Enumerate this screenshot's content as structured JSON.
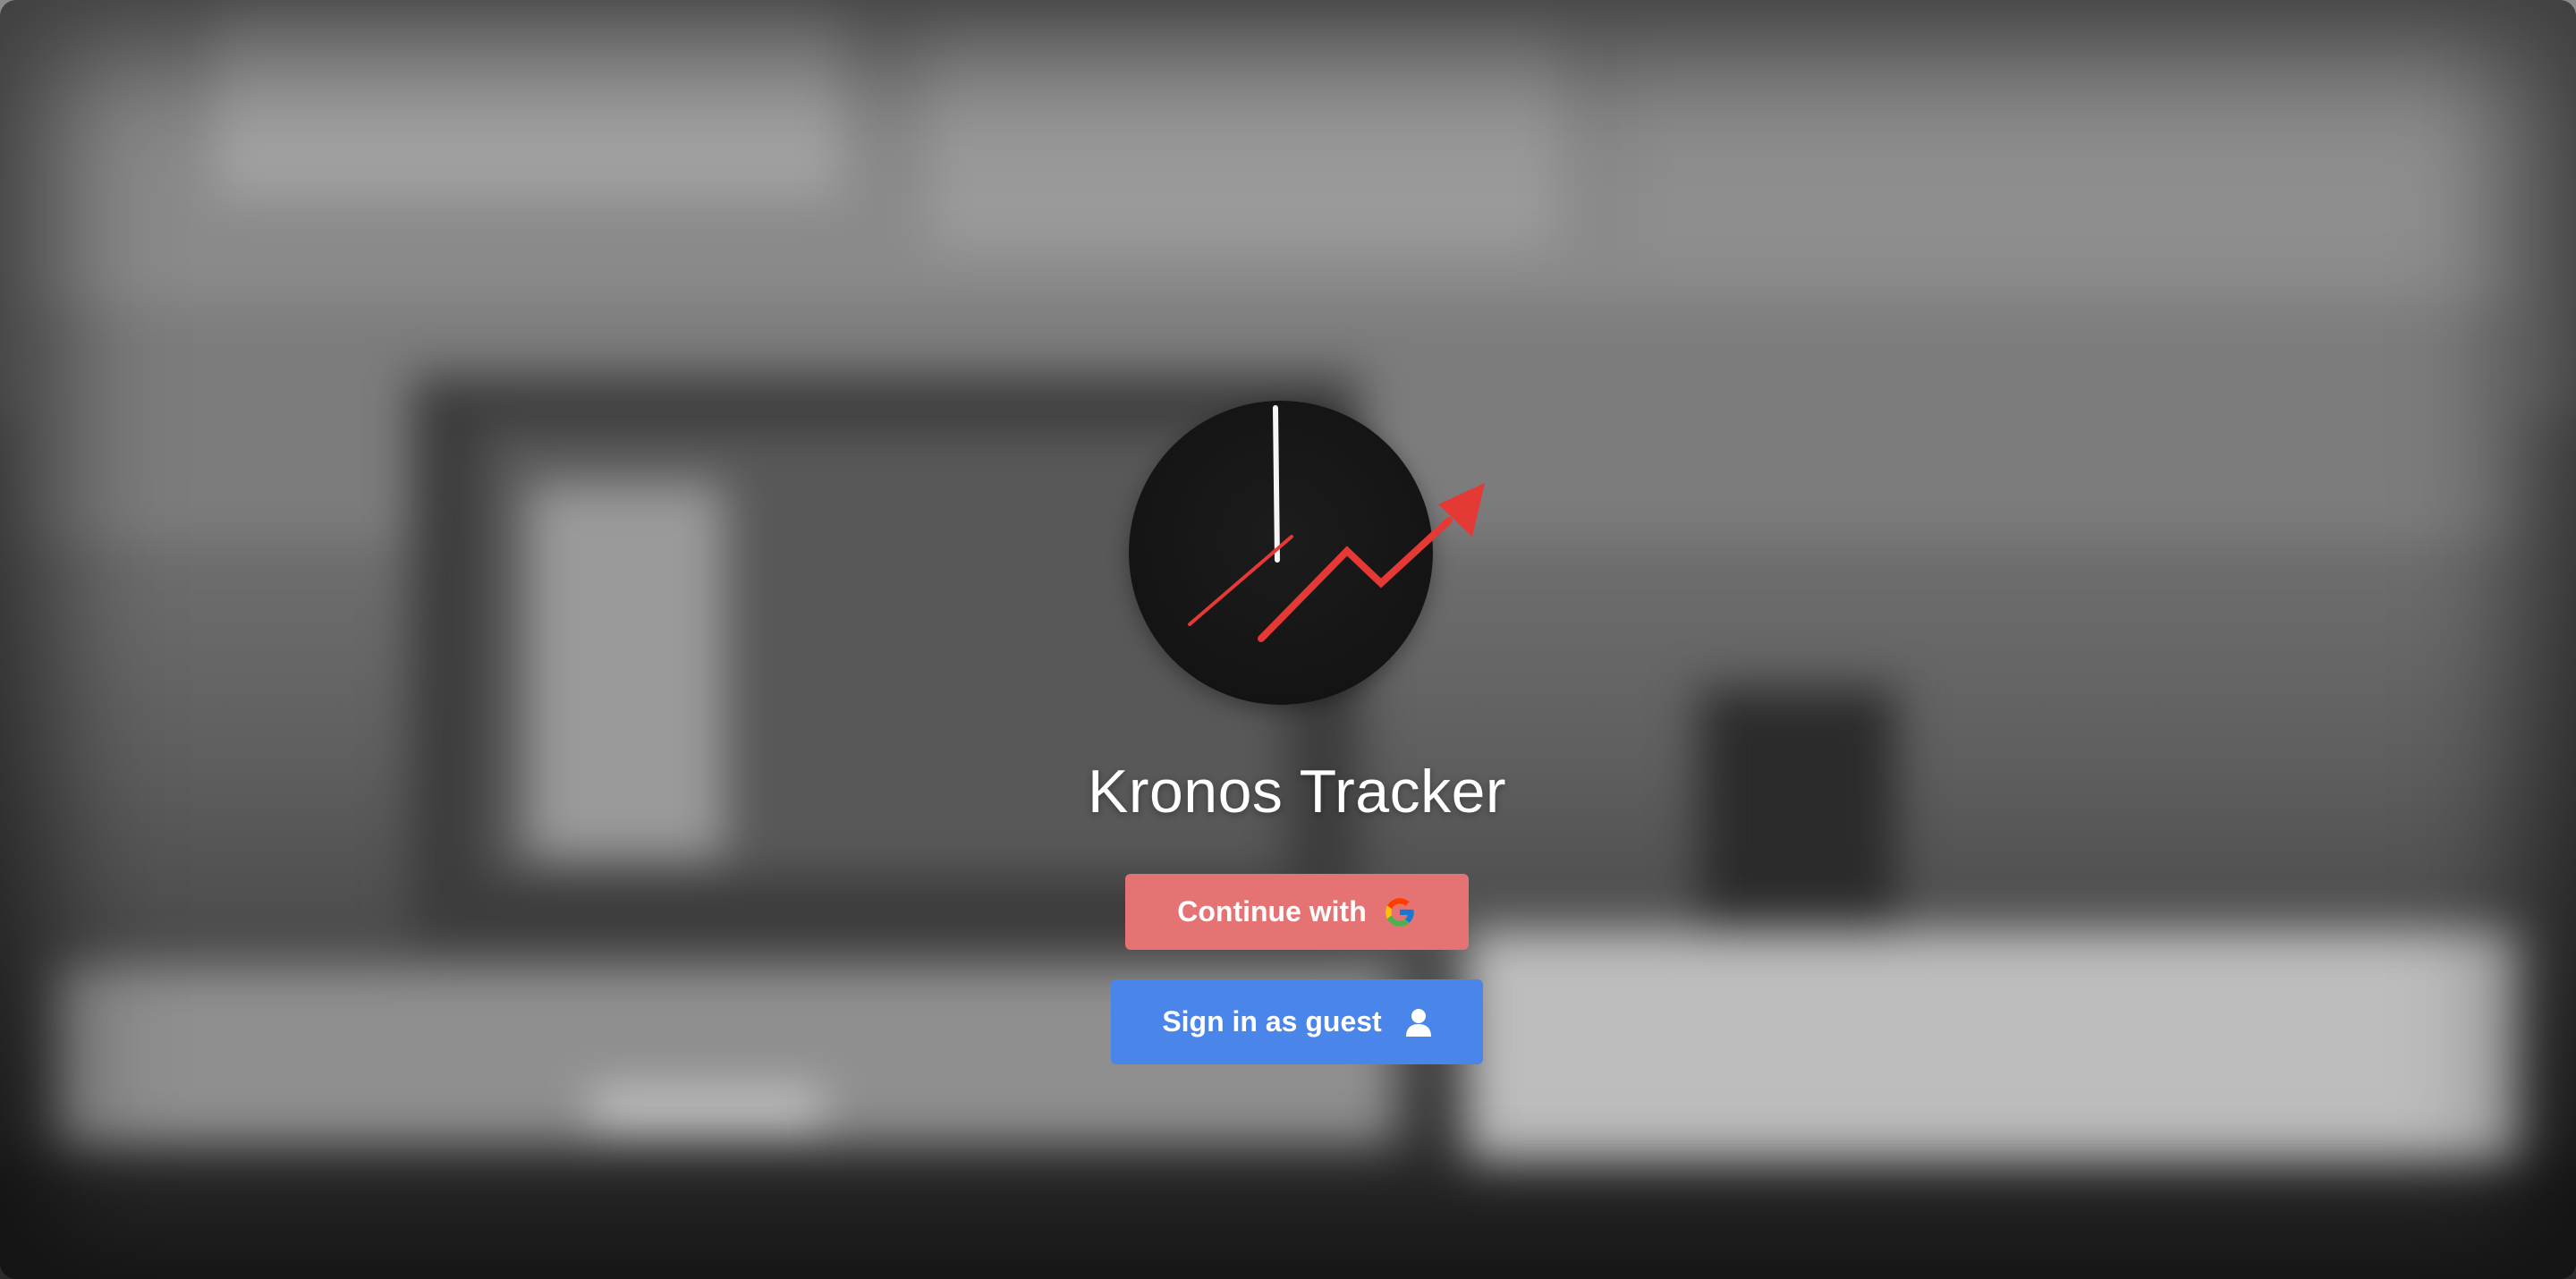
{
  "app": {
    "title": "Kronos Tracker"
  },
  "actions": {
    "google": {
      "label": "Continue with",
      "icon": "google-g-icon"
    },
    "guest": {
      "label": "Sign in as guest",
      "icon": "person-icon"
    }
  },
  "logo": {
    "icon": "clock-trend-icon"
  },
  "colors": {
    "google_button": "#e57373",
    "guest_button": "#4a86ea",
    "logo_background": "#151515",
    "logo_accent": "#e53935",
    "title_text": "#ffffff"
  }
}
